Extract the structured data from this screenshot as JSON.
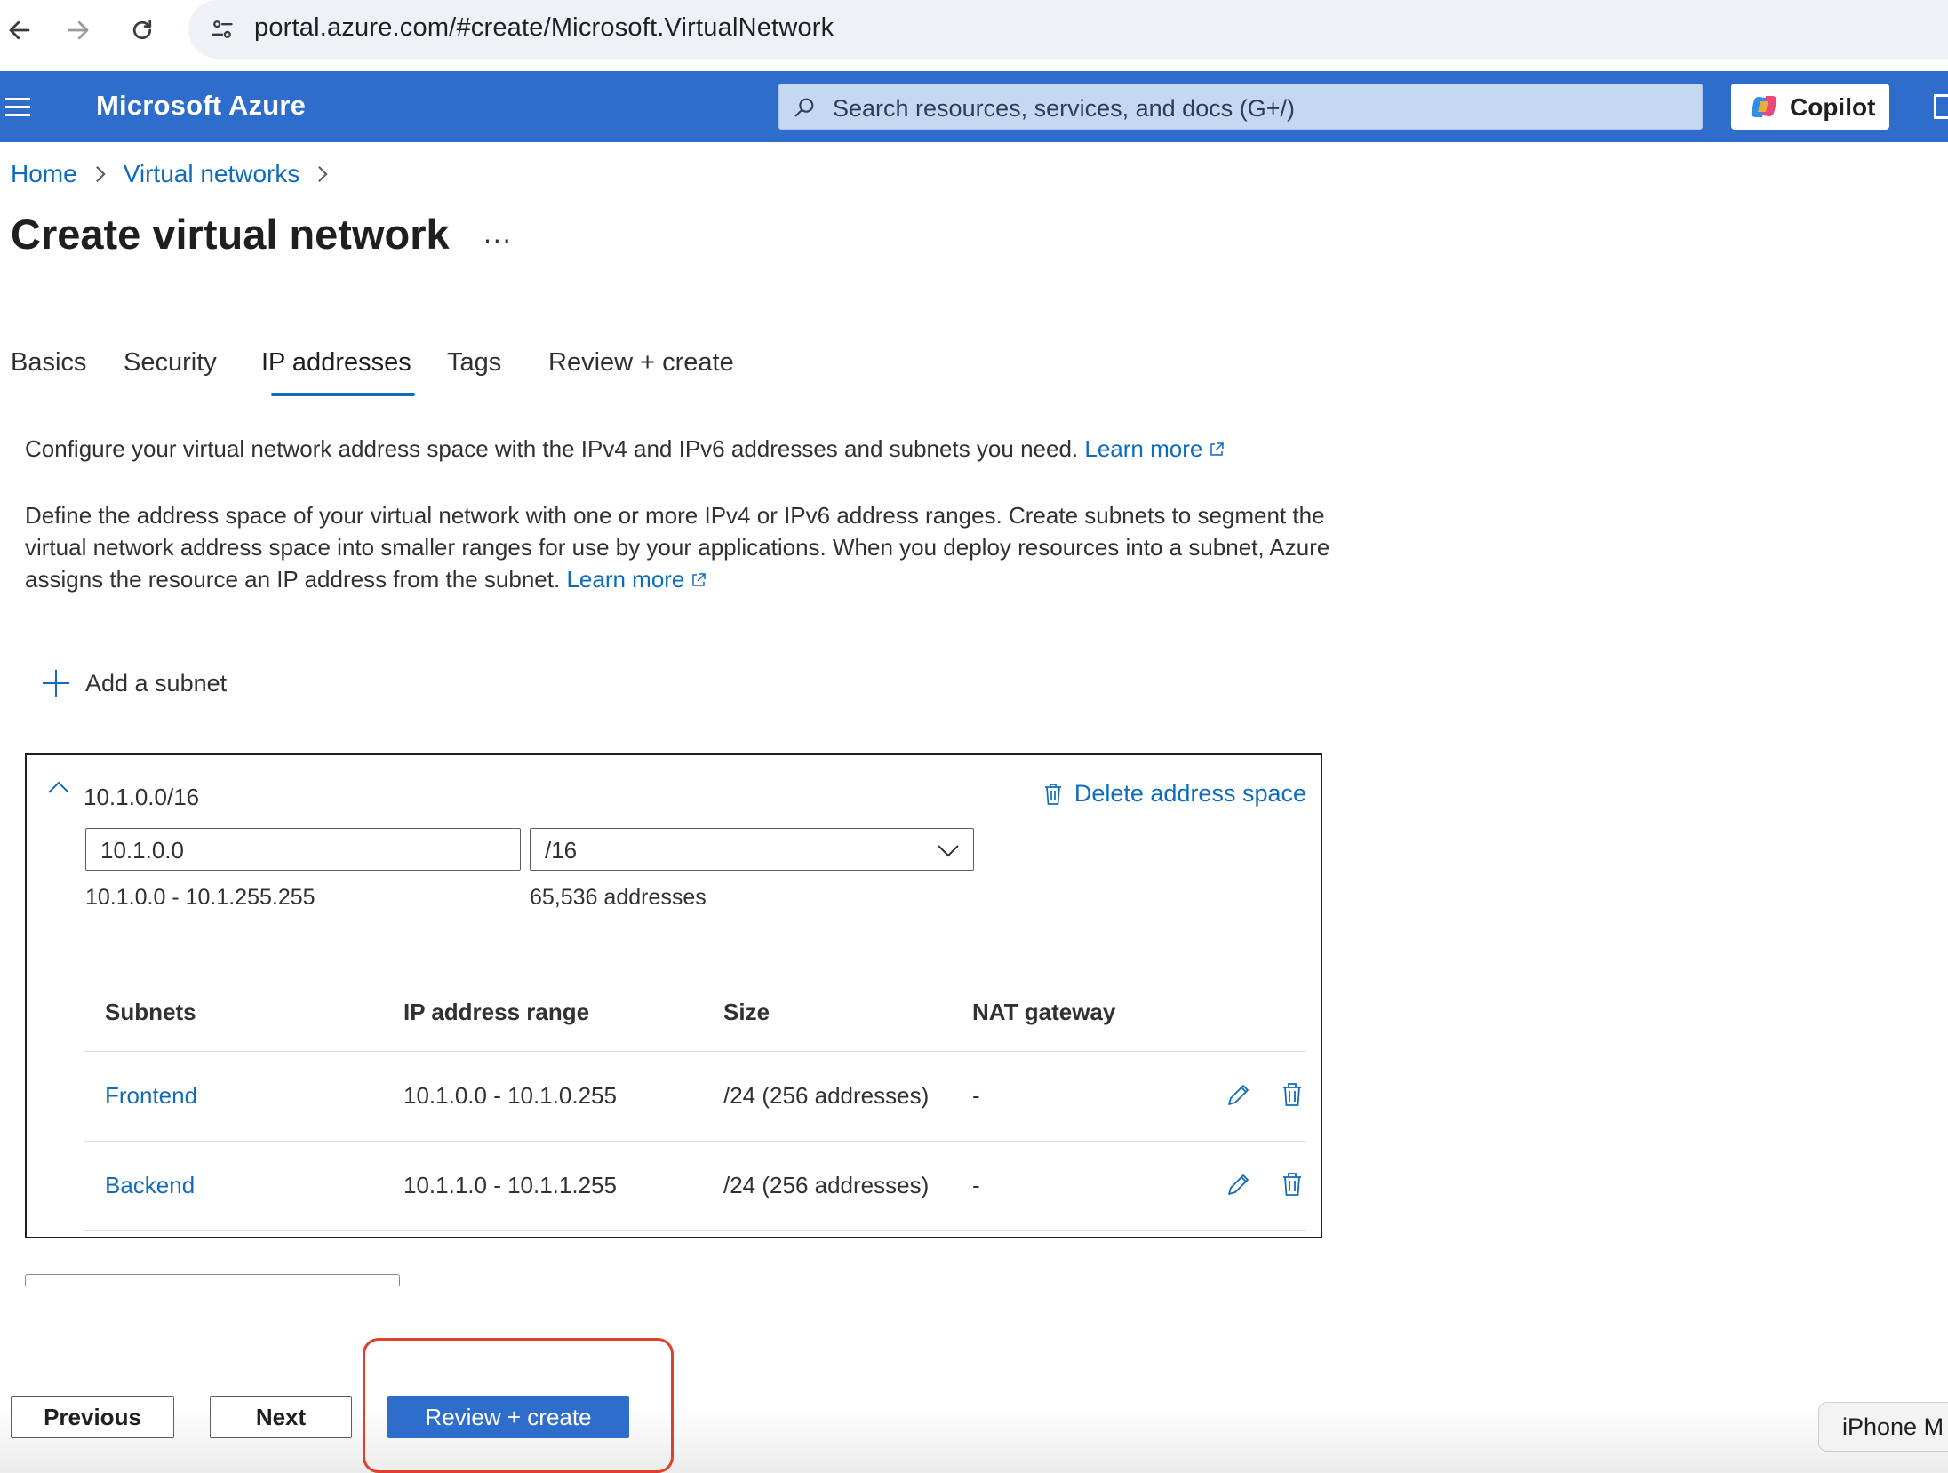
{
  "browser": {
    "url": "portal.azure.com/#create/Microsoft.VirtualNetwork"
  },
  "header": {
    "brand": "Microsoft Azure",
    "search_placeholder": "Search resources, services, and docs (G+/)",
    "copilot_label": "Copilot",
    "accent_color": "#2f6dcc"
  },
  "breadcrumb": {
    "items": [
      "Home",
      "Virtual networks"
    ]
  },
  "page": {
    "title": "Create virtual network",
    "more": "..."
  },
  "tabs": [
    {
      "label": "Basics",
      "active": false
    },
    {
      "label": "Security",
      "active": false
    },
    {
      "label": "IP addresses",
      "active": true
    },
    {
      "label": "Tags",
      "active": false
    },
    {
      "label": "Review + create",
      "active": false
    }
  ],
  "description": {
    "line1": "Configure your virtual network address space with the IPv4 and IPv6 addresses and subnets you need.",
    "line1_link": "Learn more",
    "para2_l1": "Define the address space of your virtual network with one or more IPv4 or IPv6 address ranges. Create subnets to segment the",
    "para2_l2": "virtual network address space into smaller ranges for use by your applications. When you deploy resources into a subnet, Azure",
    "para2_l3": "assigns the resource an IP address from the subnet.",
    "para2_link": "Learn more"
  },
  "add_subnet_label": "Add a subnet",
  "address_space": {
    "title": "10.1.0.0/16",
    "delete_label": "Delete address space",
    "address_value": "10.1.0.0",
    "prefix_value": "/16",
    "range": "10.1.0.0 - 10.1.255.255",
    "count": "65,536 addresses",
    "columns": [
      "Subnets",
      "IP address range",
      "Size",
      "NAT gateway"
    ],
    "subnets": [
      {
        "name": "Frontend",
        "range": "10.1.0.0 - 10.1.0.255",
        "size": "/24 (256 addresses)",
        "nat": "-"
      },
      {
        "name": "Backend",
        "range": "10.1.1.0 - 10.1.1.255",
        "size": "/24 (256 addresses)",
        "nat": "-"
      }
    ]
  },
  "footer": {
    "previous": "Previous",
    "next": "Next",
    "review_create": "Review + create",
    "device_tag": "iPhone M"
  }
}
